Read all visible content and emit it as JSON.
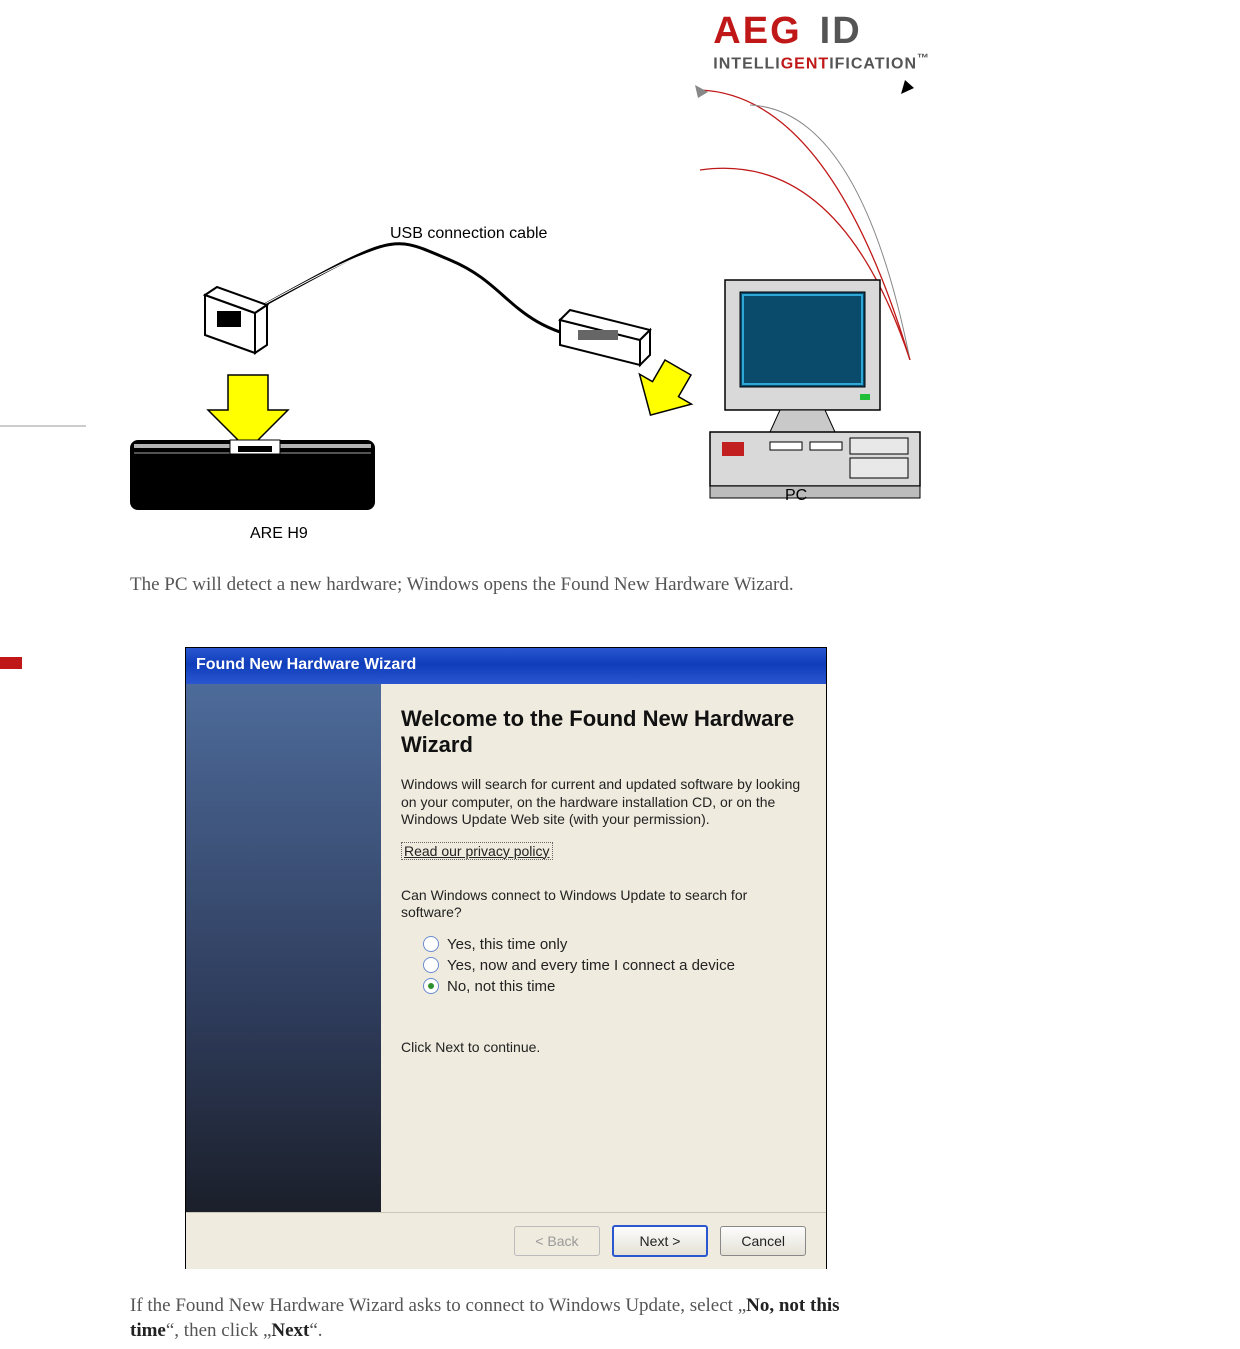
{
  "brand": {
    "aeg": "AEG",
    "id": "ID",
    "tagline_intelli": "INTELLI",
    "tagline_gent": "GENT",
    "tagline_ification": "IFICATION",
    "tm": "™"
  },
  "diagram": {
    "usb_label": "USB connection cable",
    "device_label": "ARE H9",
    "pc_label": "PC"
  },
  "text": {
    "para1": "The PC will detect a new hardware; Windows opens the Found New Hardware Wizard.",
    "para2_a": "If the Found New Hardware Wizard asks to connect to Windows Update, select „",
    "para2_b": "No, not this time",
    "para2_c": "“, then click „",
    "para2_d": "Next",
    "para2_e": "“."
  },
  "wizard": {
    "title": "Found New Hardware Wizard",
    "heading": "Welcome to the Found New Hardware Wizard",
    "intro": "Windows will search for current and updated software by looking on your computer, on the hardware installation CD, or on the Windows Update Web site (with your permission).",
    "privacy": "Read our privacy policy",
    "question": "Can Windows connect to Windows Update to search for software?",
    "opt1": "Yes, this time only",
    "opt2": "Yes, now and every time I connect a device",
    "opt3": "No, not this time",
    "continue": "Click Next to continue.",
    "back": "< Back",
    "next": "Next >",
    "cancel": "Cancel"
  }
}
